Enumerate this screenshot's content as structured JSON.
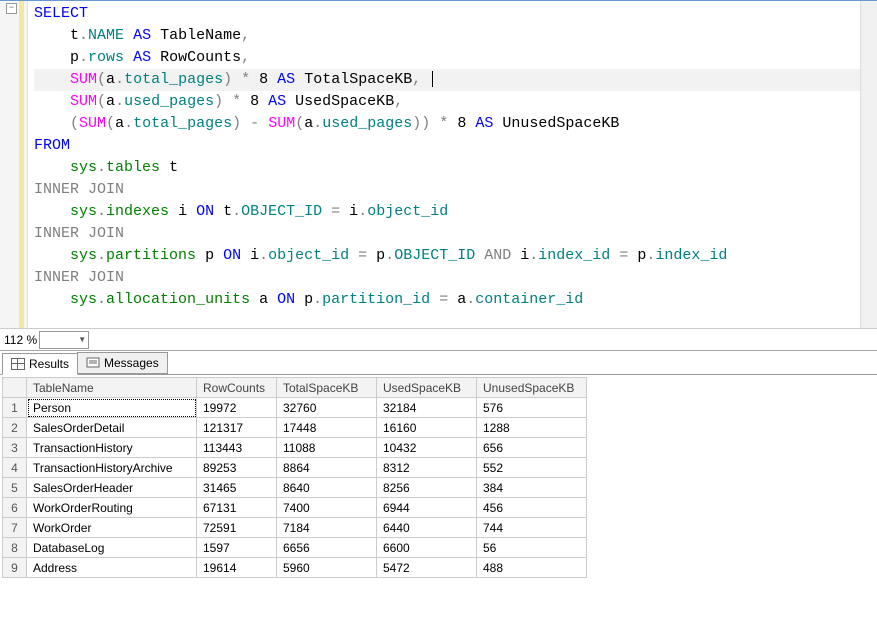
{
  "editor": {
    "zoom": "112 %",
    "outline_symbol": "−",
    "tokens": [
      [
        [
          "kw",
          "SELECT"
        ]
      ],
      [
        [
          "",
          null
        ],
        [
          "",
          "    t"
        ],
        [
          "gray",
          "."
        ],
        [
          "col",
          "NAME"
        ],
        [
          "",
          " "
        ],
        [
          "kw",
          "AS"
        ],
        [
          "",
          " TableName"
        ],
        [
          "gray",
          ","
        ]
      ],
      [
        [
          "",
          null
        ],
        [
          "",
          "    p"
        ],
        [
          "gray",
          "."
        ],
        [
          "col",
          "rows"
        ],
        [
          "",
          " "
        ],
        [
          "kw",
          "AS"
        ],
        [
          "",
          " RowCounts"
        ],
        [
          "gray",
          ","
        ]
      ],
      [
        [
          "",
          null
        ],
        [
          "",
          "    "
        ],
        [
          "fn",
          "SUM"
        ],
        [
          "gray",
          "("
        ],
        [
          "",
          "a"
        ],
        [
          "gray",
          "."
        ],
        [
          "col",
          "total_pages"
        ],
        [
          "gray",
          ")"
        ],
        [
          "",
          " "
        ],
        [
          "gray",
          "*"
        ],
        [
          "",
          " 8 "
        ],
        [
          "kw",
          "AS"
        ],
        [
          "",
          " TotalSpaceKB"
        ],
        [
          "gray",
          ","
        ],
        [
          "",
          " "
        ]
      ],
      [
        [
          "",
          null
        ],
        [
          "",
          "    "
        ],
        [
          "fn",
          "SUM"
        ],
        [
          "gray",
          "("
        ],
        [
          "",
          "a"
        ],
        [
          "gray",
          "."
        ],
        [
          "col",
          "used_pages"
        ],
        [
          "gray",
          ")"
        ],
        [
          "",
          " "
        ],
        [
          "gray",
          "*"
        ],
        [
          "",
          " 8 "
        ],
        [
          "kw",
          "AS"
        ],
        [
          "",
          " UsedSpaceKB"
        ],
        [
          "gray",
          ","
        ]
      ],
      [
        [
          "",
          null
        ],
        [
          "",
          "    "
        ],
        [
          "gray",
          "("
        ],
        [
          "fn",
          "SUM"
        ],
        [
          "gray",
          "("
        ],
        [
          "",
          "a"
        ],
        [
          "gray",
          "."
        ],
        [
          "col",
          "total_pages"
        ],
        [
          "gray",
          ")"
        ],
        [
          "",
          " "
        ],
        [
          "gray",
          "-"
        ],
        [
          "",
          " "
        ],
        [
          "fn",
          "SUM"
        ],
        [
          "gray",
          "("
        ],
        [
          "",
          "a"
        ],
        [
          "gray",
          "."
        ],
        [
          "col",
          "used_pages"
        ],
        [
          "gray",
          "))"
        ],
        [
          "",
          " "
        ],
        [
          "gray",
          "*"
        ],
        [
          "",
          " 8 "
        ],
        [
          "kw",
          "AS"
        ],
        [
          "",
          " UnusedSpaceKB"
        ]
      ],
      [
        [
          "kw",
          "FROM"
        ]
      ],
      [
        [
          "",
          null
        ],
        [
          "",
          "    "
        ],
        [
          "obj",
          "sys"
        ],
        [
          "gray",
          "."
        ],
        [
          "obj",
          "tables"
        ],
        [
          "",
          " t"
        ]
      ],
      [
        [
          "gray",
          "INNER JOIN"
        ]
      ],
      [
        [
          "",
          null
        ],
        [
          "",
          "    "
        ],
        [
          "obj",
          "sys"
        ],
        [
          "gray",
          "."
        ],
        [
          "obj",
          "indexes"
        ],
        [
          "",
          " i "
        ],
        [
          "kw",
          "ON"
        ],
        [
          "",
          " t"
        ],
        [
          "gray",
          "."
        ],
        [
          "col",
          "OBJECT_ID"
        ],
        [
          "",
          " "
        ],
        [
          "gray",
          "="
        ],
        [
          "",
          " i"
        ],
        [
          "gray",
          "."
        ],
        [
          "col",
          "object_id"
        ]
      ],
      [
        [
          "gray",
          "INNER JOIN"
        ]
      ],
      [
        [
          "",
          null
        ],
        [
          "",
          "    "
        ],
        [
          "obj",
          "sys"
        ],
        [
          "gray",
          "."
        ],
        [
          "obj",
          "partitions"
        ],
        [
          "",
          " p "
        ],
        [
          "kw",
          "ON"
        ],
        [
          "",
          " i"
        ],
        [
          "gray",
          "."
        ],
        [
          "col",
          "object_id"
        ],
        [
          "",
          " "
        ],
        [
          "gray",
          "="
        ],
        [
          "",
          " p"
        ],
        [
          "gray",
          "."
        ],
        [
          "col",
          "OBJECT_ID"
        ],
        [
          "",
          " "
        ],
        [
          "gray",
          "AND"
        ],
        [
          "",
          " i"
        ],
        [
          "gray",
          "."
        ],
        [
          "col",
          "index_id"
        ],
        [
          "",
          " "
        ],
        [
          "gray",
          "="
        ],
        [
          "",
          " p"
        ],
        [
          "gray",
          "."
        ],
        [
          "col",
          "index_id"
        ]
      ],
      [
        [
          "gray",
          "INNER JOIN"
        ]
      ],
      [
        [
          "",
          null
        ],
        [
          "",
          "    "
        ],
        [
          "obj",
          "sys"
        ],
        [
          "gray",
          "."
        ],
        [
          "obj",
          "allocation_units"
        ],
        [
          "",
          " a "
        ],
        [
          "kw",
          "ON"
        ],
        [
          "",
          " p"
        ],
        [
          "gray",
          "."
        ],
        [
          "col",
          "partition_id"
        ],
        [
          "",
          " "
        ],
        [
          "gray",
          "="
        ],
        [
          "",
          " a"
        ],
        [
          "gray",
          "."
        ],
        [
          "col",
          "container_id"
        ]
      ]
    ],
    "current_line_index": 3
  },
  "tabs": {
    "results": "Results",
    "messages": "Messages"
  },
  "grid": {
    "columns": [
      "TableName",
      "RowCounts",
      "TotalSpaceKB",
      "UsedSpaceKB",
      "UnusedSpaceKB"
    ],
    "rows": [
      [
        "Person",
        "19972",
        "32760",
        "32184",
        "576"
      ],
      [
        "SalesOrderDetail",
        "121317",
        "17448",
        "16160",
        "1288"
      ],
      [
        "TransactionHistory",
        "113443",
        "11088",
        "10432",
        "656"
      ],
      [
        "TransactionHistoryArchive",
        "89253",
        "8864",
        "8312",
        "552"
      ],
      [
        "SalesOrderHeader",
        "31465",
        "8640",
        "8256",
        "384"
      ],
      [
        "WorkOrderRouting",
        "67131",
        "7400",
        "6944",
        "456"
      ],
      [
        "WorkOrder",
        "72591",
        "7184",
        "6440",
        "744"
      ],
      [
        "DatabaseLog",
        "1597",
        "6656",
        "6600",
        "56"
      ],
      [
        "Address",
        "19614",
        "5960",
        "5472",
        "488"
      ]
    ]
  }
}
